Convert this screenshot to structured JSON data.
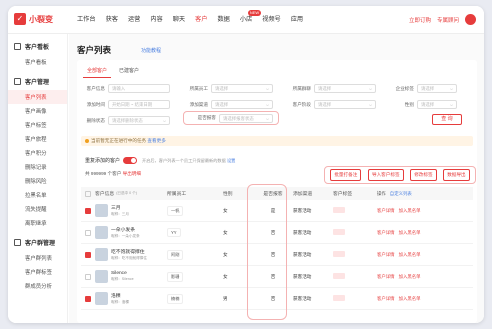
{
  "brand": {
    "name": "小裂变"
  },
  "nav": [
    "工作台",
    "获客",
    "运营",
    "内容",
    "聊天",
    "客户",
    "数据",
    "小店",
    "视频号",
    "应用"
  ],
  "nav_badge": "NEW",
  "top_right": {
    "link1": "立即订购",
    "link2": "专属顾问"
  },
  "sidebar": {
    "group1": "客户看板",
    "group1_items": [
      "客户看板"
    ],
    "group2": "客户管理",
    "group2_items": [
      "客户列表",
      "客户画像",
      "客户标签",
      "客户旅程",
      "客户积分",
      "删除记录",
      "删除风险",
      "拉黑名单",
      "流失提醒",
      "离职继承"
    ],
    "group3": "客户群管理",
    "group3_items": [
      "客户群列表",
      "客户群标签",
      "群成员分析"
    ]
  },
  "page": {
    "title": "客户列表",
    "help": "功能教程"
  },
  "tabs": [
    "全部客户",
    "已建客户"
  ],
  "filters": {
    "row1": [
      {
        "label": "客户信息",
        "placeholder": "请输入"
      },
      {
        "label": "所属员工",
        "placeholder": "请选择"
      },
      {
        "label": "所属群聊",
        "placeholder": "请选择"
      },
      {
        "label": "企业标签",
        "placeholder": "请选择"
      }
    ],
    "row2": [
      {
        "label": "添加时间",
        "placeholder": "开始日期 ~ 结束日期"
      },
      {
        "label": "添加渠道",
        "placeholder": "请选择"
      },
      {
        "label": "客户阶段",
        "placeholder": "请选择"
      },
      {
        "label": "性别",
        "placeholder": "请选择"
      }
    ],
    "row3": [
      {
        "label": "删除状态",
        "placeholder": "请选择删除状态"
      },
      {
        "label": "是否报客",
        "placeholder": "请选择报客状态"
      }
    ],
    "search": "查 询"
  },
  "notice": {
    "text": "当前暂无正在进行中的任务",
    "link": "查看更多"
  },
  "toggle": {
    "label": "重复添加的客户",
    "desc": "开启后，客户列表一个员工只保留最新的数据 ",
    "link": "设置"
  },
  "count": {
    "prefix": "共",
    "value": "999999",
    "suffix": "个客户",
    "link": "导出明细"
  },
  "actions": [
    "批量打备注",
    "导入客户标签",
    "修改标签",
    "数据导出"
  ],
  "table": {
    "headers": [
      "客户信息",
      "所属员工",
      "性别",
      "是否报客",
      "添加渠道",
      "客户标签",
      "操作"
    ],
    "header_sub": "(已选中 0 个)",
    "ops_header_link": "自定义列表",
    "rows": [
      {
        "checked": true,
        "name": "三月",
        "sub": "昵称：三月",
        "staff": "一帆",
        "gender": "女",
        "mark": "是",
        "channel": "获客活动",
        "ops": [
          "客户详情",
          "加入黑名单"
        ]
      },
      {
        "checked": false,
        "name": "一朵小发条",
        "sub": "昵称：一朵小发条",
        "staff": "YY",
        "gender": "女",
        "mark": "否",
        "channel": "获客活动",
        "ops": [
          "客户详情",
          "加入黑名单"
        ]
      },
      {
        "checked": true,
        "name": "吃不饱就得撑住",
        "sub": "昵称：吃不饱就得撑住",
        "staff": "阿刚",
        "gender": "女",
        "mark": "否",
        "channel": "获客活动",
        "ops": [
          "客户详情",
          "加入黑名单"
        ]
      },
      {
        "checked": false,
        "name": "Silence",
        "sub": "昵称：Silence",
        "staff": "影珊",
        "gender": "女",
        "mark": "否",
        "channel": "获客活动",
        "ops": [
          "客户详情",
          "加入黑名单"
        ]
      },
      {
        "checked": true,
        "name": "洛稞",
        "sub": "昵称：洛稞",
        "staff": "楠楠",
        "gender": "男",
        "mark": "否",
        "channel": "获客活动",
        "ops": [
          "客户详情",
          "加入黑名单"
        ]
      }
    ]
  },
  "colors": {
    "accent": "#e63c3c",
    "link": "#4a7fe0"
  }
}
